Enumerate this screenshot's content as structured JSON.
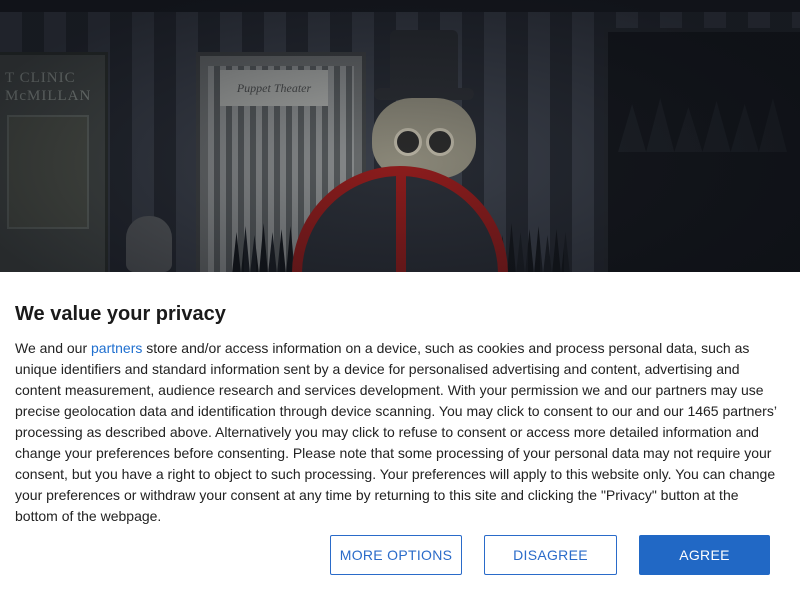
{
  "background": {
    "poster_left_text": "T CLINIC\nMcMILLAN",
    "poster_mid_label": "Puppet Theater"
  },
  "consent": {
    "title": "We value your privacy",
    "text_before_link": "We and our ",
    "link_text": "partners",
    "text_after_link": " store and/or access information on a device, such as cookies and process personal data, such as unique identifiers and standard information sent by a device for personalised advertising and content, advertising and content measurement, audience research and services development. With your permission we and our partners may use precise geolocation data and identification through device scanning. You may click to consent to our and our 1465 partners’ processing as described above. Alternatively you may click to refuse to consent or access more detailed information and change your preferences before consenting. Please note that some processing of your personal data may not require your consent, but you have a right to object to such processing. Your preferences will apply to this website only. You can change your preferences or withdraw your consent at any time by returning to this site and clicking the \"Privacy\" button at the bottom of the webpage.",
    "buttons": {
      "more_options": "MORE OPTIONS",
      "disagree": "DISAGREE",
      "agree": "AGREE"
    }
  },
  "colors": {
    "accent": "#2168c5",
    "link": "#1f6fcf",
    "emblem_red": "#8c1c1c"
  }
}
